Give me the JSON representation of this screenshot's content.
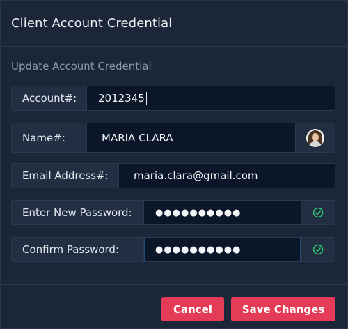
{
  "dialog": {
    "title": "Client Account Credential",
    "subtitle": "Update Account Credential"
  },
  "fields": {
    "account": {
      "label": "Account#:",
      "value": "2012345"
    },
    "name": {
      "label": "Name#:",
      "value": "MARIA CLARA",
      "icon": "avatar-photo"
    },
    "email": {
      "label": "Email Address#:",
      "value": "maria.clara@gmail.com"
    },
    "new_password": {
      "label": "Enter New Password:",
      "value": "●●●●●●●●●●",
      "icon": "check-circle-icon"
    },
    "confirm_password": {
      "label": "Confirm Password:",
      "value": "●●●●●●●●●●",
      "icon": "check-circle-icon"
    }
  },
  "buttons": {
    "cancel": "Cancel",
    "save": "Save Changes"
  },
  "colors": {
    "accent": "#e43b57",
    "valid": "#2ecc71",
    "dialog_bg": "#1b2638",
    "input_bg": "#0b1628"
  }
}
